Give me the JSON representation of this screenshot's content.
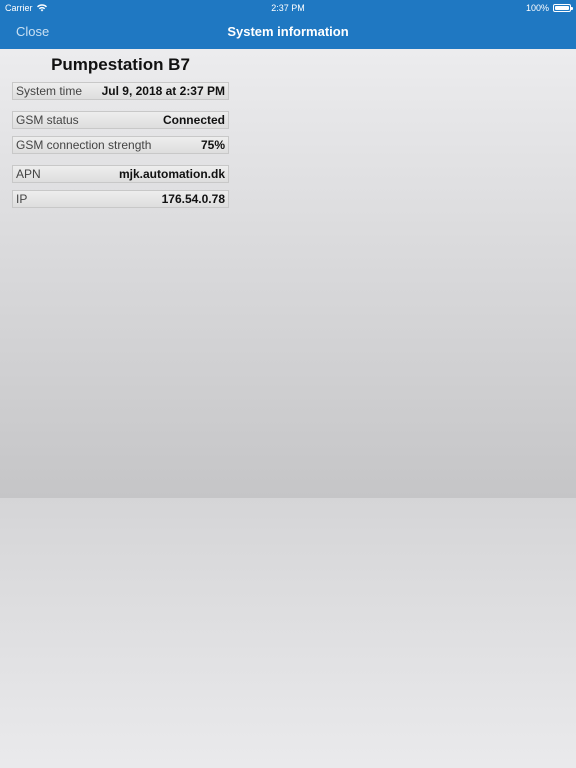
{
  "status_bar": {
    "carrier": "Carrier",
    "time": "2:37 PM",
    "battery": "100%"
  },
  "nav": {
    "close_label": "Close",
    "title": "System information"
  },
  "station": {
    "name": "Pumpestation B7"
  },
  "rows": [
    {
      "label": "System time",
      "value": "Jul 9, 2018 at 2:37 PM"
    },
    {
      "label": "GSM status",
      "value": "Connected"
    },
    {
      "label": "GSM connection strength",
      "value": "75%"
    },
    {
      "label": "APN",
      "value": "mjk.automation.dk"
    },
    {
      "label": "IP",
      "value": "176.54.0.78"
    }
  ],
  "colors": {
    "nav_background": "#1f78c2",
    "nav_text": "#ffffff"
  }
}
